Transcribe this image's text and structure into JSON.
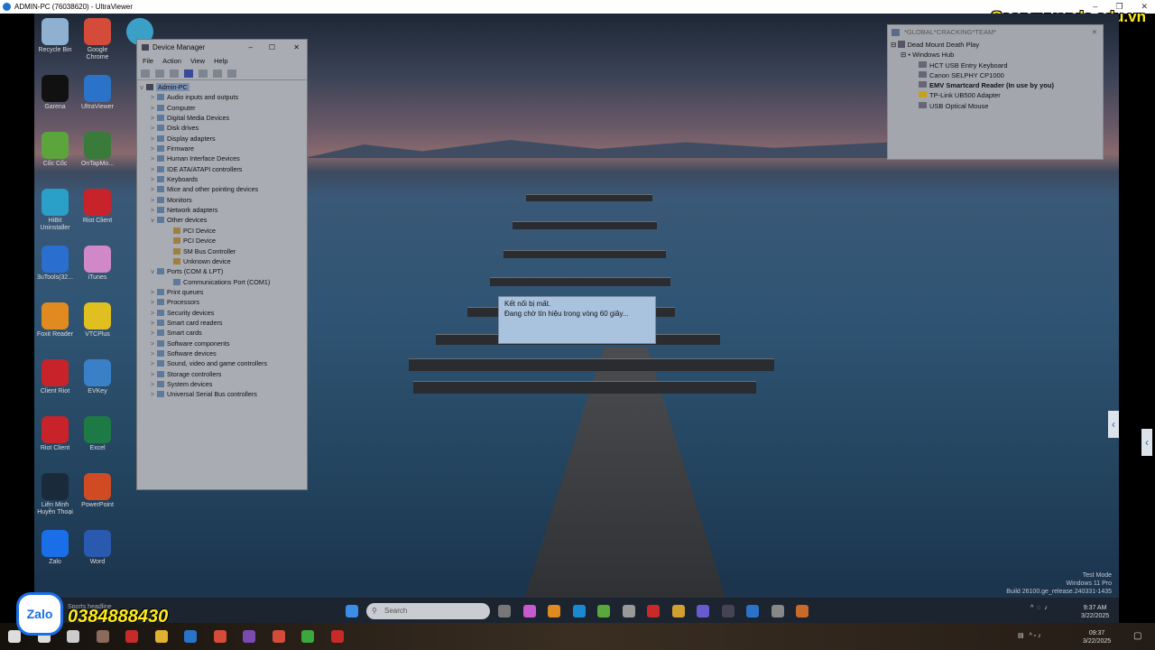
{
  "window": {
    "title": "ADMIN-PC (76038620) - UltraViewer",
    "min": "–",
    "max": "❐",
    "close": "✕"
  },
  "brand": "Caonguyenda.edu.vn",
  "promo": {
    "zalo": "Zalo",
    "phone": "0384888430",
    "news": "Sports headline"
  },
  "desktop_icons": [
    {
      "label": "Recycle Bin",
      "color": "#8fb0d0"
    },
    {
      "label": "Google Chrome",
      "color": "#d44b3a"
    },
    {
      "label": "Garena",
      "color": "#111"
    },
    {
      "label": "UltraViewer",
      "color": "#2a73c8"
    },
    {
      "label": "Cốc Cốc",
      "color": "#5ca53c"
    },
    {
      "label": "OnTapMo...",
      "color": "#3a7a3a"
    },
    {
      "label": "HiBit Uninstaller",
      "color": "#2aa0c8"
    },
    {
      "label": "Riot Client",
      "color": "#c8232a"
    },
    {
      "label": "3uTools(32...",
      "color": "#2a6ed0"
    },
    {
      "label": "iTunes",
      "color": "#d088c8"
    },
    {
      "label": "Foxit Reader",
      "color": "#e08a20"
    },
    {
      "label": "VTCPlus",
      "color": "#e0c020"
    },
    {
      "label": "Client Riot",
      "color": "#c8232a"
    },
    {
      "label": "EVKey",
      "color": "#3a80c8"
    },
    {
      "label": "Riot Client",
      "color": "#c8232a"
    },
    {
      "label": "Excel",
      "color": "#1e7a44"
    },
    {
      "label": "Liên Minh Huyền Thoại",
      "color": "#1a2a3a"
    },
    {
      "label": "PowerPoint",
      "color": "#d04a24"
    },
    {
      "label": "Zalo",
      "color": "#1a6ee8"
    },
    {
      "label": "Word",
      "color": "#2a5ab0"
    }
  ],
  "device_manager": {
    "title": "Device Manager",
    "menu": [
      "File",
      "Action",
      "View",
      "Help"
    ],
    "root": "Admin-PC",
    "nodes": [
      {
        "label": "Audio inputs and outputs",
        "level": 1,
        "exp": ">"
      },
      {
        "label": "Computer",
        "level": 1,
        "exp": ">"
      },
      {
        "label": "Digital Media Devices",
        "level": 1,
        "exp": ">"
      },
      {
        "label": "Disk drives",
        "level": 1,
        "exp": ">"
      },
      {
        "label": "Display adapters",
        "level": 1,
        "exp": ">"
      },
      {
        "label": "Firmware",
        "level": 1,
        "exp": ">"
      },
      {
        "label": "Human Interface Devices",
        "level": 1,
        "exp": ">"
      },
      {
        "label": "IDE ATA/ATAPI controllers",
        "level": 1,
        "exp": ">"
      },
      {
        "label": "Keyboards",
        "level": 1,
        "exp": ">"
      },
      {
        "label": "Mice and other pointing devices",
        "level": 1,
        "exp": ">"
      },
      {
        "label": "Monitors",
        "level": 1,
        "exp": ">"
      },
      {
        "label": "Network adapters",
        "level": 1,
        "exp": ">"
      },
      {
        "label": "Other devices",
        "level": 1,
        "exp": "v"
      },
      {
        "label": "PCI Device",
        "level": 2,
        "exp": ""
      },
      {
        "label": "PCI Device",
        "level": 2,
        "exp": ""
      },
      {
        "label": "SM Bus Controller",
        "level": 2,
        "exp": ""
      },
      {
        "label": "Unknown device",
        "level": 2,
        "exp": ""
      },
      {
        "label": "Ports (COM & LPT)",
        "level": 1,
        "exp": "v"
      },
      {
        "label": "Communications Port (COM1)",
        "level": 2,
        "exp": ""
      },
      {
        "label": "Print queues",
        "level": 1,
        "exp": ">"
      },
      {
        "label": "Processors",
        "level": 1,
        "exp": ">"
      },
      {
        "label": "Security devices",
        "level": 1,
        "exp": ">"
      },
      {
        "label": "Smart card readers",
        "level": 1,
        "exp": ">"
      },
      {
        "label": "Smart cards",
        "level": 1,
        "exp": ">"
      },
      {
        "label": "Software components",
        "level": 1,
        "exp": ">"
      },
      {
        "label": "Software devices",
        "level": 1,
        "exp": ">"
      },
      {
        "label": "Sound, video and game controllers",
        "level": 1,
        "exp": ">"
      },
      {
        "label": "Storage controllers",
        "level": 1,
        "exp": ">"
      },
      {
        "label": "System devices",
        "level": 1,
        "exp": ">"
      },
      {
        "label": "Universal Serial Bus controllers",
        "level": 1,
        "exp": ">"
      }
    ]
  },
  "hub": {
    "title": "*GLOBAL*CRACKING*TEAM*",
    "root": "Dead Mount Death Play",
    "hub": "Windows Hub",
    "devices": [
      "HCT USB Entry Keyboard",
      "Canon SELPHY CP1000",
      "EMV Smartcard Reader (In use by you)",
      "TP-Link UB500 Adapter",
      "USB Optical Mouse"
    ]
  },
  "dialog": {
    "line1": "Kết nối bị mất.",
    "line2": "Đang chờ tín hiệu trong vòng 60 giây..."
  },
  "watermark": {
    "line1": "Test Mode",
    "line2": "Windows 11 Pro",
    "line3": "Build 26100.ge_release.240331-1435"
  },
  "inner_taskbar": {
    "search": "Search",
    "time": "9:37 AM",
    "date": "3/22/2025"
  },
  "outer_taskbar": {
    "time": "09:37",
    "date": "3/22/2025"
  }
}
